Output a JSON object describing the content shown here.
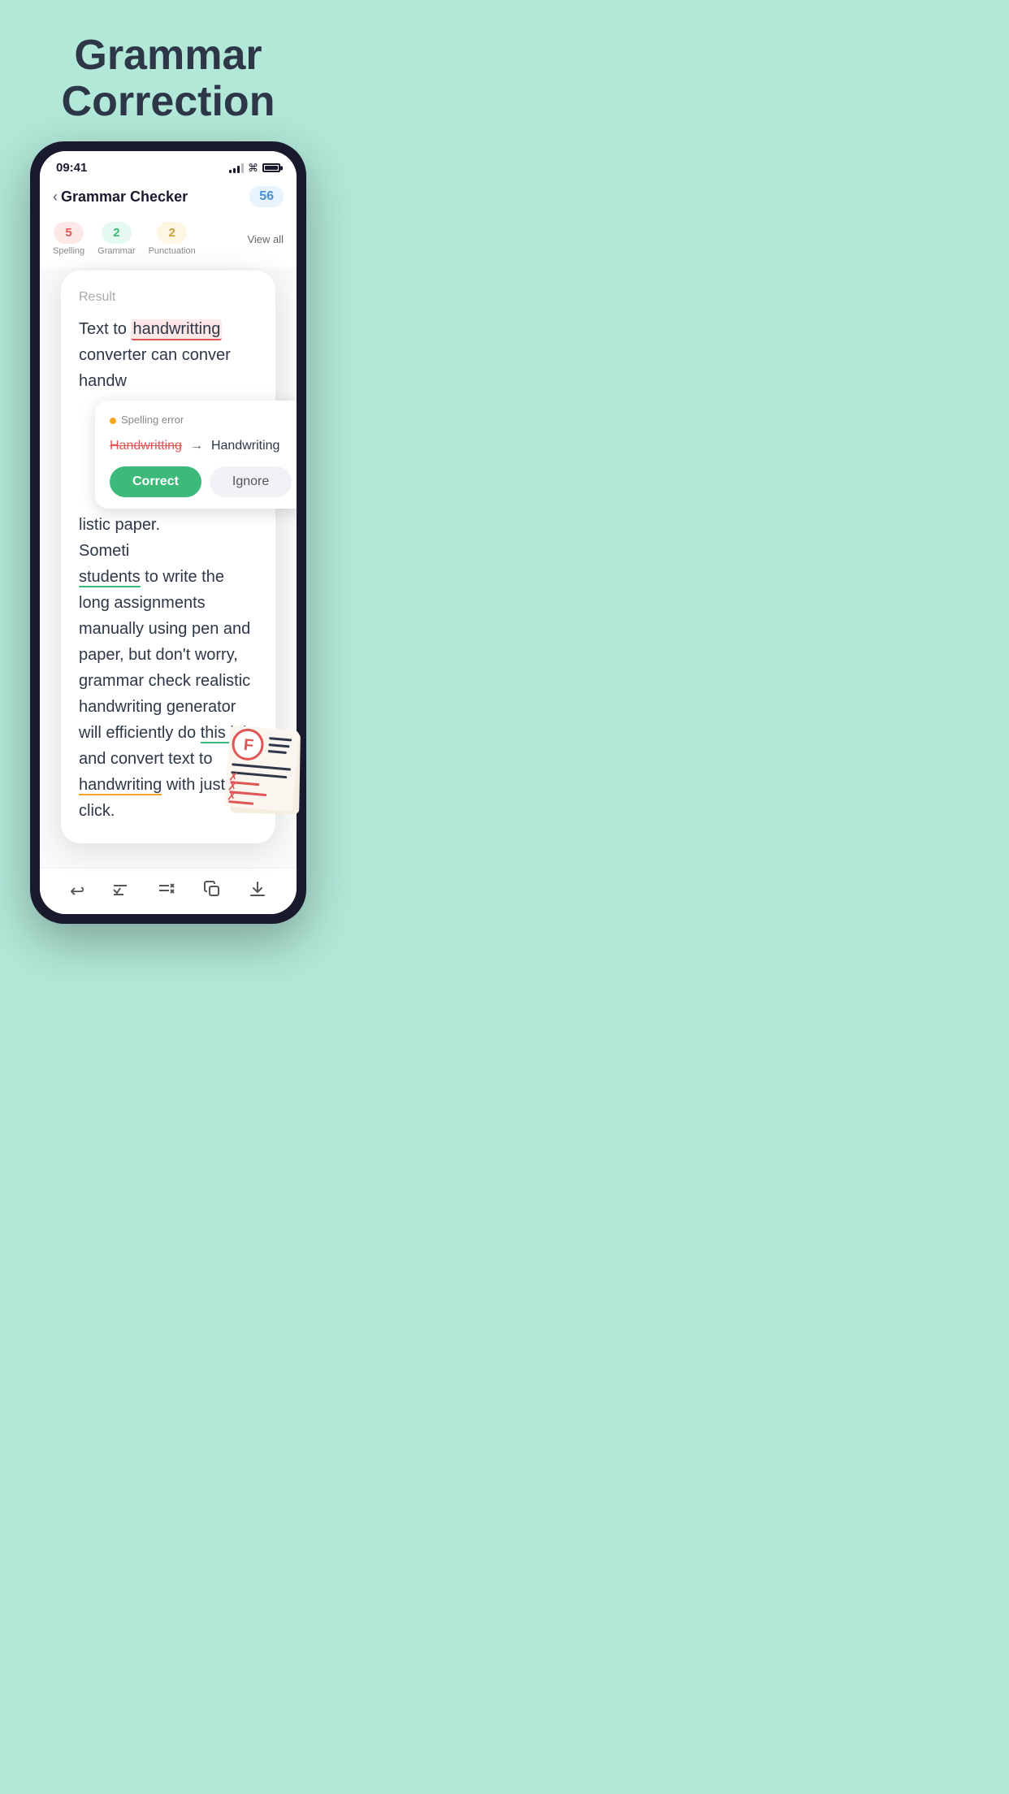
{
  "page": {
    "background": "#b2e8d8",
    "title_line1": "Grammar",
    "title_line2": "Correction"
  },
  "status_bar": {
    "time": "09:41",
    "signal": "signal-icon",
    "wifi": "wifi-icon",
    "battery": "battery-icon"
  },
  "header": {
    "back_label": "‹",
    "title": "Grammar Checker",
    "count": "56",
    "view_all": "View all"
  },
  "categories": [
    {
      "count": "5",
      "label": "Spelling",
      "type": "spelling"
    },
    {
      "count": "2",
      "label": "Grammar",
      "type": "grammar"
    },
    {
      "count": "2",
      "label": "Punctuation",
      "type": "punctuation"
    }
  ],
  "result_label": "Result",
  "result_text_parts": [
    {
      "text": "Text to ",
      "type": "normal"
    },
    {
      "text": "handwritting",
      "type": "spelling-error"
    },
    {
      "text": " converter can conver",
      "type": "normal"
    },
    {
      "text": "handw",
      "type": "normal"
    },
    {
      "text": "listic paper.",
      "type": "normal"
    },
    {
      "text": "Someti",
      "type": "normal"
    },
    {
      "text": "students",
      "type": "grammar-error"
    },
    {
      "text": " to write the long assignments manually using pen and paper, but don't worry, grammar check realistic handwriting generator will efficiently do ",
      "type": "normal"
    },
    {
      "text": "this job",
      "type": "grammar-error"
    },
    {
      "text": " and convert text to ",
      "type": "normal"
    },
    {
      "text": "handwriting",
      "type": "punctuation-error"
    },
    {
      "text": " with just one click.",
      "type": "normal"
    }
  ],
  "tooltip": {
    "error_type": "Spelling error",
    "original": "Handwritting",
    "corrected": "Handwriting",
    "correct_btn": "Correct",
    "ignore_btn": "Ignore"
  },
  "toolbar": {
    "undo": "↩",
    "check": "✓≡",
    "clear": "≡✕",
    "copy": "⧉",
    "download": "⬇"
  }
}
